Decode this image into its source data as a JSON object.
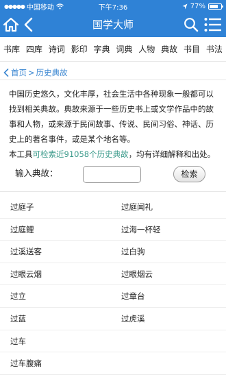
{
  "status_bar": {
    "carrier": "中国移动",
    "time": "下午7:36",
    "battery": "77%",
    "battery_level": 0.77
  },
  "nav": {
    "title": "国学大师",
    "home_icon": "home-icon",
    "back_icon": "back-icon",
    "search_icon": "search-icon",
    "menu_icon": "menu-icon"
  },
  "tabs": [
    "书库",
    "四库",
    "诗词",
    "影印",
    "字典",
    "词典",
    "人物",
    "典故",
    "书目",
    "书法"
  ],
  "breadcrumb": {
    "home": "首页",
    "separator": ">",
    "current": "历史典故"
  },
  "description": {
    "paragraph": "中国历史悠久，文化丰厚，社会生活中各种现象一般都可以找到相关典故。典故来源于一些历史书上或文学作品中的故事和人物，或来源于民间故事、传说、民间习俗、神话、历史上的著名事件，或是某个地名等。",
    "line_prefix": "本工具",
    "highlight": "可检索近91058个历史典故",
    "line_suffix": "，均有详细解释和出处。"
  },
  "search": {
    "label": "输入典故：",
    "value": "",
    "placeholder": "",
    "button": "检索"
  },
  "results": [
    [
      "过庭子",
      "过庭闻礼"
    ],
    [
      "过庭鲤",
      "过海一杯轻"
    ],
    [
      "过溪送客",
      "过白驹"
    ],
    [
      "过眼云烟",
      "过眼烟云"
    ],
    [
      "过立",
      "过章台"
    ],
    [
      "过蓝",
      "过虎溪"
    ],
    [
      "过车",
      ""
    ],
    [
      "过车腹痛",
      ""
    ]
  ],
  "colors": {
    "primary": "#2f82d6",
    "link": "#3a86d1",
    "highlight": "#3a9a8a"
  }
}
